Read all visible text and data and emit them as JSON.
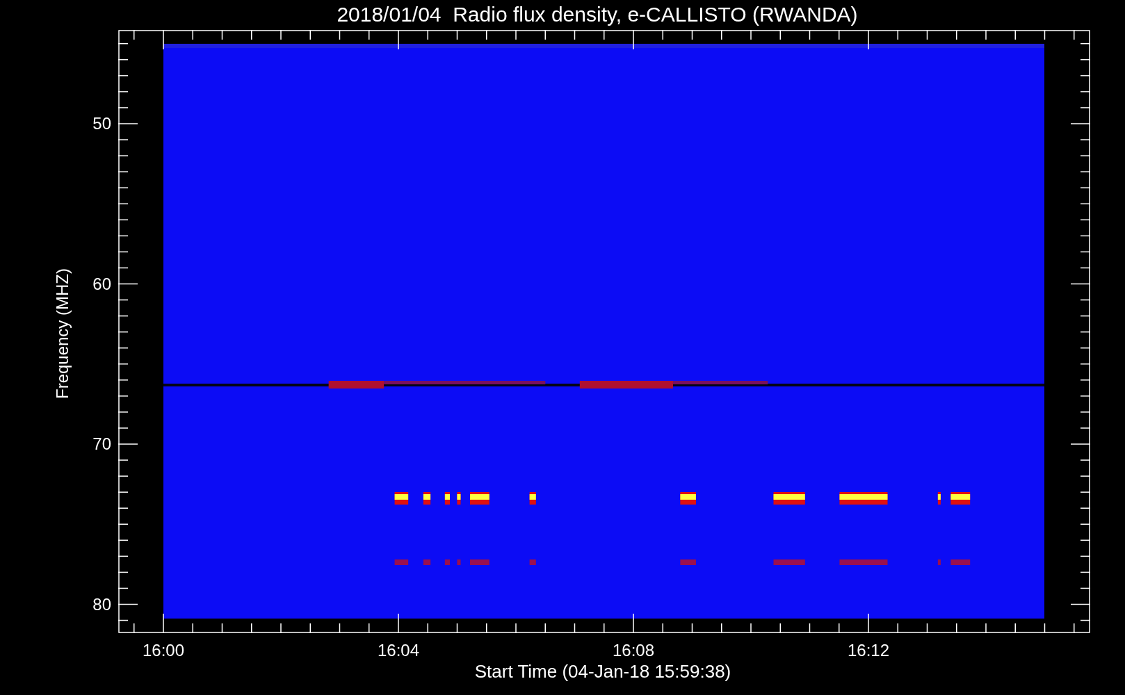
{
  "title": "2018/01/04  Radio flux density, e-CALLISTO (RWANDA)",
  "y_axis": {
    "label": "Frequency (MHZ)",
    "ticks": [
      {
        "label": "50"
      },
      {
        "label": "60"
      },
      {
        "label": "70"
      },
      {
        "label": "80"
      }
    ]
  },
  "x_axis": {
    "label": "Start Time (04-Jan-18 15:59:38)",
    "ticks": [
      {
        "label": "16:00"
      },
      {
        "label": "16:04"
      },
      {
        "label": "16:08"
      },
      {
        "label": "16:12"
      }
    ]
  }
}
